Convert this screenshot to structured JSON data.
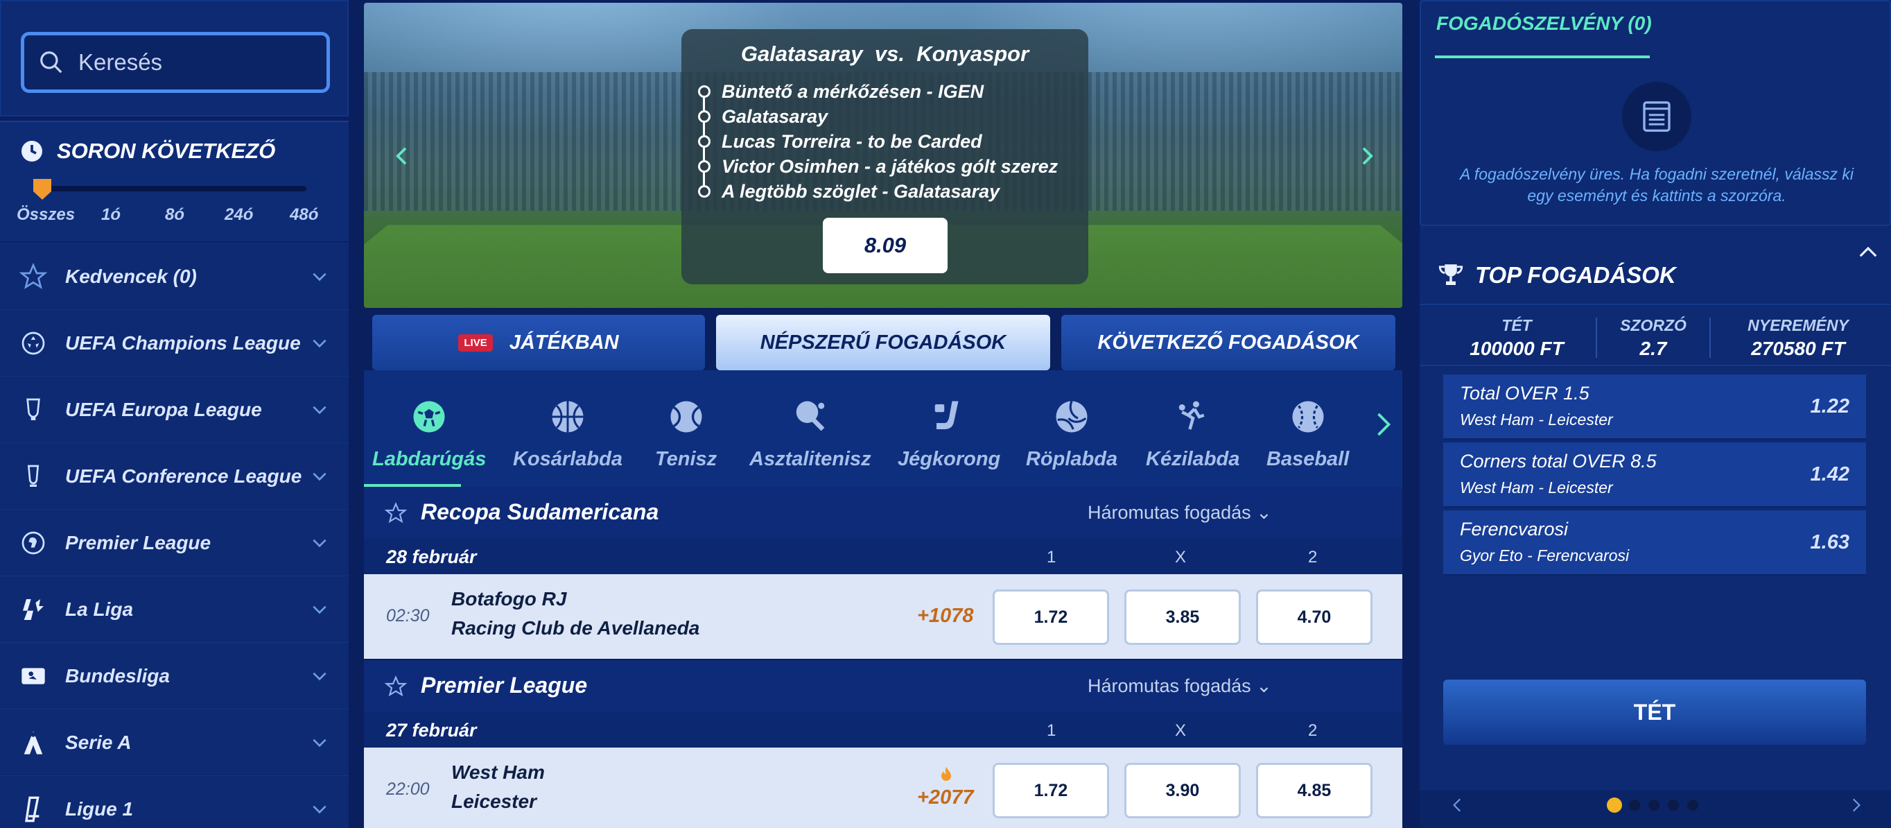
{
  "search": {
    "placeholder": "Keresés"
  },
  "upcoming": {
    "title": "SORON KÖVETKEZŐ",
    "slider_labels": [
      "Összes",
      "1ó",
      "8ó",
      "24ó",
      "48ó"
    ],
    "slider_value": 0
  },
  "sidebar": {
    "items": [
      {
        "label": "Kedvencek (0)",
        "icon": "star-icon"
      },
      {
        "label": "UEFA Champions League",
        "icon": "champions-league-icon"
      },
      {
        "label": "UEFA Europa League",
        "icon": "europa-league-icon"
      },
      {
        "label": "UEFA Conference League",
        "icon": "conference-league-icon"
      },
      {
        "label": "Premier League",
        "icon": "premier-league-icon"
      },
      {
        "label": "La Liga",
        "icon": "la-liga-icon"
      },
      {
        "label": "Bundesliga",
        "icon": "bundesliga-icon"
      },
      {
        "label": "Serie A",
        "icon": "serie-a-icon"
      },
      {
        "label": "Ligue 1",
        "icon": "ligue-1-icon"
      }
    ]
  },
  "hero": {
    "home": "Galatasaray",
    "vs": "vs.",
    "away": "Konyaspor",
    "legs": [
      "Büntető a mérkőzésen - IGEN",
      "Galatasaray",
      "Lucas Torreira - to be Carded",
      "Victor Osimhen - a játékos gólt szerez",
      "A legtöbb szöglet - Galatasaray"
    ],
    "odds": "8.09"
  },
  "tabs": {
    "live_badge": "LIVE",
    "live": "JÁTÉKBAN",
    "popular": "NÉPSZERŰ FOGADÁSOK",
    "next": "KÖVETKEZŐ FOGADÁSOK"
  },
  "sports": [
    {
      "label": "Labdarúgás",
      "icon": "football-icon",
      "active": true
    },
    {
      "label": "Kosárlabda",
      "icon": "basketball-icon"
    },
    {
      "label": "Tenisz",
      "icon": "tennis-icon"
    },
    {
      "label": "Asztalitenisz",
      "icon": "table-tennis-icon"
    },
    {
      "label": "Jégkorong",
      "icon": "ice-hockey-icon"
    },
    {
      "label": "Röplabda",
      "icon": "volleyball-icon"
    },
    {
      "label": "Kézilabda",
      "icon": "handball-icon"
    },
    {
      "label": "Baseball",
      "icon": "baseball-icon"
    }
  ],
  "leagues": [
    {
      "name": "Recopa Sudamericana",
      "market": "Háromutas fogadás",
      "date": "28 február",
      "cols": [
        "1",
        "X",
        "2"
      ],
      "match": {
        "time": "02:30",
        "home": "Botafogo RJ",
        "away": "Racing Club de Avellaneda",
        "more": "+1078",
        "odds": [
          "1.72",
          "3.85",
          "4.70"
        ]
      }
    },
    {
      "name": "Premier League",
      "market": "Háromutas fogadás",
      "date": "27 február",
      "cols": [
        "1",
        "X",
        "2"
      ],
      "match": {
        "time": "22:00",
        "home": "West Ham",
        "away": "Leicester",
        "more": "+2077",
        "hot": true,
        "odds": [
          "1.72",
          "3.90",
          "4.85"
        ]
      }
    }
  ],
  "slip": {
    "title": "FOGADÓSZELVÉNY (0)",
    "empty_line1": "A fogadószelvény üres. Ha fogadni szeretnél, válassz ki",
    "empty_line2": "egy eseményt és kattints a szorzóra."
  },
  "top": {
    "title": "TOP FOGADÁSOK",
    "stake_label": "TÉT",
    "stake": "100000 FT",
    "mult_label": "SZORZÓ",
    "mult": "2.7",
    "win_label": "NYEREMÉNY",
    "win": "270580 FT",
    "bets": [
      {
        "title": "Total OVER 1.5",
        "event": "West Ham - Leicester",
        "odd": "1.22"
      },
      {
        "title": "Corners total OVER 8.5",
        "event": "West Ham - Leicester",
        "odd": "1.42"
      },
      {
        "title": "Ferencvarosi",
        "event": "Gyor Eto - Ferencvarosi",
        "odd": "1.63"
      }
    ],
    "button": "TÉT",
    "pager": {
      "pages": 5,
      "current": 1
    }
  },
  "colors": {
    "accent": "#5ee8c2",
    "bg": "#0a1f5e",
    "slider": "#f39a2e",
    "odds_more": "#c46a1c"
  }
}
